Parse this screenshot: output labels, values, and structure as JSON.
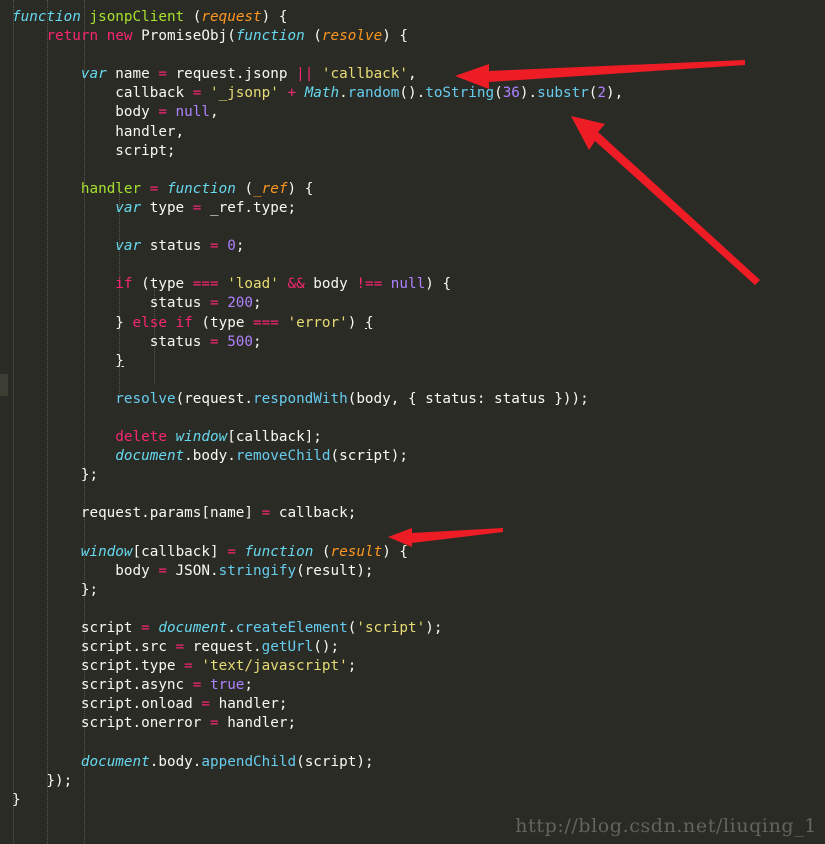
{
  "editor": {
    "background_color": "#2b2b26",
    "default_text_color": "#f8f8f2",
    "language": "JavaScript",
    "indent_guide_color": "#55564d",
    "colors": {
      "keyword": "#f92672",
      "operator": "#f92672",
      "storage_italic": "#66d9ef",
      "declaration_name": "#a6e22e",
      "function_call": "#66ccee",
      "parameter": "#fd971f",
      "string": "#e6db74",
      "number_constant": "#ae81ff",
      "plain": "#f8f8f2",
      "annotation_arrow": "#ee1c25",
      "watermark": "#63645c"
    }
  },
  "code": {
    "lines": [
      [
        {
          "t": "function",
          "c": "ital"
        },
        {
          "t": " ",
          "c": "pln"
        },
        {
          "t": "jsonpClient",
          "c": "fnname"
        },
        {
          "t": " (",
          "c": "pln"
        },
        {
          "t": "request",
          "c": "param"
        },
        {
          "t": ") {",
          "c": "pln"
        }
      ],
      [
        {
          "t": "    ",
          "c": "pln"
        },
        {
          "t": "return",
          "c": "kw"
        },
        {
          "t": " ",
          "c": "pln"
        },
        {
          "t": "new",
          "c": "kw"
        },
        {
          "t": " PromiseObj(",
          "c": "pln"
        },
        {
          "t": "function",
          "c": "ital"
        },
        {
          "t": " (",
          "c": "pln"
        },
        {
          "t": "resolve",
          "c": "param"
        },
        {
          "t": ") {",
          "c": "pln"
        }
      ],
      [],
      [
        {
          "t": "        ",
          "c": "pln"
        },
        {
          "t": "var",
          "c": "ital"
        },
        {
          "t": " name ",
          "c": "pln"
        },
        {
          "t": "=",
          "c": "op"
        },
        {
          "t": " request.jsonp ",
          "c": "pln"
        },
        {
          "t": "||",
          "c": "op"
        },
        {
          "t": " ",
          "c": "pln"
        },
        {
          "t": "'callback'",
          "c": "str"
        },
        {
          "t": ",",
          "c": "pln"
        }
      ],
      [
        {
          "t": "            callback ",
          "c": "pln"
        },
        {
          "t": "=",
          "c": "op"
        },
        {
          "t": " ",
          "c": "pln"
        },
        {
          "t": "'_jsonp'",
          "c": "str"
        },
        {
          "t": " ",
          "c": "pln"
        },
        {
          "t": "+",
          "c": "op"
        },
        {
          "t": " ",
          "c": "pln"
        },
        {
          "t": "Math",
          "c": "ital"
        },
        {
          "t": ".",
          "c": "pln"
        },
        {
          "t": "random",
          "c": "call"
        },
        {
          "t": "().",
          "c": "pln"
        },
        {
          "t": "toString",
          "c": "call"
        },
        {
          "t": "(",
          "c": "pln"
        },
        {
          "t": "36",
          "c": "num"
        },
        {
          "t": ").",
          "c": "pln"
        },
        {
          "t": "substr",
          "c": "call"
        },
        {
          "t": "(",
          "c": "pln"
        },
        {
          "t": "2",
          "c": "num"
        },
        {
          "t": "),",
          "c": "pln"
        }
      ],
      [
        {
          "t": "            body ",
          "c": "pln"
        },
        {
          "t": "=",
          "c": "op"
        },
        {
          "t": " ",
          "c": "pln"
        },
        {
          "t": "null",
          "c": "num"
        },
        {
          "t": ",",
          "c": "pln"
        }
      ],
      [
        {
          "t": "            handler,",
          "c": "pln"
        }
      ],
      [
        {
          "t": "            script;",
          "c": "pln"
        }
      ],
      [],
      [
        {
          "t": "        ",
          "c": "pln"
        },
        {
          "t": "handler",
          "c": "fnname"
        },
        {
          "t": " ",
          "c": "pln"
        },
        {
          "t": "=",
          "c": "op"
        },
        {
          "t": " ",
          "c": "pln"
        },
        {
          "t": "function",
          "c": "ital"
        },
        {
          "t": " (",
          "c": "pln"
        },
        {
          "t": "_ref",
          "c": "param"
        },
        {
          "t": ") {",
          "c": "pln"
        }
      ],
      [
        {
          "t": "            ",
          "c": "pln"
        },
        {
          "t": "var",
          "c": "ital"
        },
        {
          "t": " type ",
          "c": "pln"
        },
        {
          "t": "=",
          "c": "op"
        },
        {
          "t": " _ref.type;",
          "c": "pln"
        }
      ],
      [],
      [
        {
          "t": "            ",
          "c": "pln"
        },
        {
          "t": "var",
          "c": "ital"
        },
        {
          "t": " status ",
          "c": "pln"
        },
        {
          "t": "=",
          "c": "op"
        },
        {
          "t": " ",
          "c": "pln"
        },
        {
          "t": "0",
          "c": "num"
        },
        {
          "t": ";",
          "c": "pln"
        }
      ],
      [],
      [
        {
          "t": "            ",
          "c": "pln"
        },
        {
          "t": "if",
          "c": "kw"
        },
        {
          "t": " (type ",
          "c": "pln"
        },
        {
          "t": "===",
          "c": "op"
        },
        {
          "t": " ",
          "c": "pln"
        },
        {
          "t": "'load'",
          "c": "str"
        },
        {
          "t": " ",
          "c": "pln"
        },
        {
          "t": "&&",
          "c": "op"
        },
        {
          "t": " body ",
          "c": "pln"
        },
        {
          "t": "!==",
          "c": "op"
        },
        {
          "t": " ",
          "c": "pln"
        },
        {
          "t": "null",
          "c": "num"
        },
        {
          "t": ") {",
          "c": "pln"
        }
      ],
      [
        {
          "t": "                status ",
          "c": "pln"
        },
        {
          "t": "=",
          "c": "op"
        },
        {
          "t": " ",
          "c": "pln"
        },
        {
          "t": "200",
          "c": "num"
        },
        {
          "t": ";",
          "c": "pln"
        }
      ],
      [
        {
          "t": "            } ",
          "c": "pln"
        },
        {
          "t": "else",
          "c": "kw"
        },
        {
          "t": " ",
          "c": "pln"
        },
        {
          "t": "if",
          "c": "kw"
        },
        {
          "t": " (type ",
          "c": "pln"
        },
        {
          "t": "===",
          "c": "op"
        },
        {
          "t": " ",
          "c": "pln"
        },
        {
          "t": "'error'",
          "c": "str"
        },
        {
          "t": ") ",
          "c": "pln"
        },
        {
          "t": "{",
          "c": "pln brace-match"
        }
      ],
      [
        {
          "t": "                status ",
          "c": "pln"
        },
        {
          "t": "=",
          "c": "op"
        },
        {
          "t": " ",
          "c": "pln"
        },
        {
          "t": "500",
          "c": "num"
        },
        {
          "t": ";",
          "c": "pln"
        }
      ],
      [
        {
          "t": "            ",
          "c": "pln"
        },
        {
          "t": "}",
          "c": "pln brace-match"
        }
      ],
      [],
      [
        {
          "t": "            ",
          "c": "pln"
        },
        {
          "t": "resolve",
          "c": "call"
        },
        {
          "t": "(request.",
          "c": "pln"
        },
        {
          "t": "respondWith",
          "c": "call"
        },
        {
          "t": "(body, { status: status }));",
          "c": "pln"
        }
      ],
      [],
      [
        {
          "t": "            ",
          "c": "pln"
        },
        {
          "t": "delete",
          "c": "kw"
        },
        {
          "t": " ",
          "c": "pln"
        },
        {
          "t": "window",
          "c": "ital"
        },
        {
          "t": "[callback];",
          "c": "pln"
        }
      ],
      [
        {
          "t": "            ",
          "c": "pln"
        },
        {
          "t": "document",
          "c": "ital"
        },
        {
          "t": ".body.",
          "c": "pln"
        },
        {
          "t": "removeChild",
          "c": "call"
        },
        {
          "t": "(script);",
          "c": "pln"
        }
      ],
      [
        {
          "t": "        };",
          "c": "pln"
        }
      ],
      [],
      [
        {
          "t": "        request.params[name] ",
          "c": "pln"
        },
        {
          "t": "=",
          "c": "op"
        },
        {
          "t": " callback;",
          "c": "pln"
        }
      ],
      [],
      [
        {
          "t": "        ",
          "c": "pln"
        },
        {
          "t": "window",
          "c": "ital"
        },
        {
          "t": "[callback] ",
          "c": "pln"
        },
        {
          "t": "=",
          "c": "op"
        },
        {
          "t": " ",
          "c": "pln"
        },
        {
          "t": "function",
          "c": "ital"
        },
        {
          "t": " (",
          "c": "pln"
        },
        {
          "t": "result",
          "c": "param"
        },
        {
          "t": ") {",
          "c": "pln"
        }
      ],
      [
        {
          "t": "            body ",
          "c": "pln"
        },
        {
          "t": "=",
          "c": "op"
        },
        {
          "t": " JSON.",
          "c": "pln"
        },
        {
          "t": "stringify",
          "c": "call"
        },
        {
          "t": "(result);",
          "c": "pln"
        }
      ],
      [
        {
          "t": "        };",
          "c": "pln"
        }
      ],
      [],
      [
        {
          "t": "        script ",
          "c": "pln"
        },
        {
          "t": "=",
          "c": "op"
        },
        {
          "t": " ",
          "c": "pln"
        },
        {
          "t": "document",
          "c": "ital"
        },
        {
          "t": ".",
          "c": "pln"
        },
        {
          "t": "createElement",
          "c": "call"
        },
        {
          "t": "(",
          "c": "pln"
        },
        {
          "t": "'script'",
          "c": "str"
        },
        {
          "t": ");",
          "c": "pln"
        }
      ],
      [
        {
          "t": "        script.src ",
          "c": "pln"
        },
        {
          "t": "=",
          "c": "op"
        },
        {
          "t": " request.",
          "c": "pln"
        },
        {
          "t": "getUrl",
          "c": "call"
        },
        {
          "t": "();",
          "c": "pln"
        }
      ],
      [
        {
          "t": "        script.type ",
          "c": "pln"
        },
        {
          "t": "=",
          "c": "op"
        },
        {
          "t": " ",
          "c": "pln"
        },
        {
          "t": "'text/javascript'",
          "c": "str"
        },
        {
          "t": ";",
          "c": "pln"
        }
      ],
      [
        {
          "t": "        script.async ",
          "c": "pln"
        },
        {
          "t": "=",
          "c": "op"
        },
        {
          "t": " ",
          "c": "pln"
        },
        {
          "t": "true",
          "c": "num"
        },
        {
          "t": ";",
          "c": "pln"
        }
      ],
      [
        {
          "t": "        script.onload ",
          "c": "pln"
        },
        {
          "t": "=",
          "c": "op"
        },
        {
          "t": " handler;",
          "c": "pln"
        }
      ],
      [
        {
          "t": "        script.onerror ",
          "c": "pln"
        },
        {
          "t": "=",
          "c": "op"
        },
        {
          "t": " handler;",
          "c": "pln"
        }
      ],
      [],
      [
        {
          "t": "        ",
          "c": "pln"
        },
        {
          "t": "document",
          "c": "ital"
        },
        {
          "t": ".body.",
          "c": "pln"
        },
        {
          "t": "appendChild",
          "c": "call"
        },
        {
          "t": "(script);",
          "c": "pln"
        }
      ],
      [
        {
          "t": "    });",
          "c": "pln"
        }
      ],
      [
        {
          "t": "}",
          "c": "pln"
        }
      ]
    ],
    "plain_text": "function jsonpClient (request) {\n    return new PromiseObj(function (resolve) {\n\n        var name = request.jsonp || 'callback',\n            callback = '_jsonp' + Math.random().toString(36).substr(2),\n            body = null,\n            handler,\n            script;\n\n        handler = function (_ref) {\n            var type = _ref.type;\n\n            var status = 0;\n\n            if (type === 'load' && body !== null) {\n                status = 200;\n            } else if (type === 'error') {\n                status = 500;\n            }\n\n            resolve(request.respondWith(body, { status: status }));\n\n            delete window[callback];\n            document.body.removeChild(script);\n        };\n\n        request.params[name] = callback;\n\n        window[callback] = function (result) {\n            body = JSON.stringify(result);\n        };\n\n        script = document.createElement('script');\n        script.src = request.getUrl();\n        script.type = 'text/javascript';\n        script.async = true;\n        script.onload = handler;\n        script.onerror = handler;\n\n        document.body.appendChild(script);\n    });\n}"
  },
  "indent_guides": {
    "x_positions": [
      13,
      47,
      84,
      119,
      154
    ]
  },
  "annotations": {
    "arrows": [
      {
        "name": "arrow-callback-default",
        "points_to": "'callback' default name",
        "direction": "left",
        "color": "#ee1c25"
      },
      {
        "name": "arrow-random-callback-id",
        "points_to": "Math.random().toString(36).substr(2)",
        "direction": "up-left",
        "color": "#ee1c25"
      },
      {
        "name": "arrow-params-assignment",
        "points_to": "request.params[name] = callback;",
        "direction": "left",
        "color": "#ee1c25"
      }
    ]
  },
  "watermark": {
    "text": "http://blog.csdn.net/liuqing_1"
  }
}
